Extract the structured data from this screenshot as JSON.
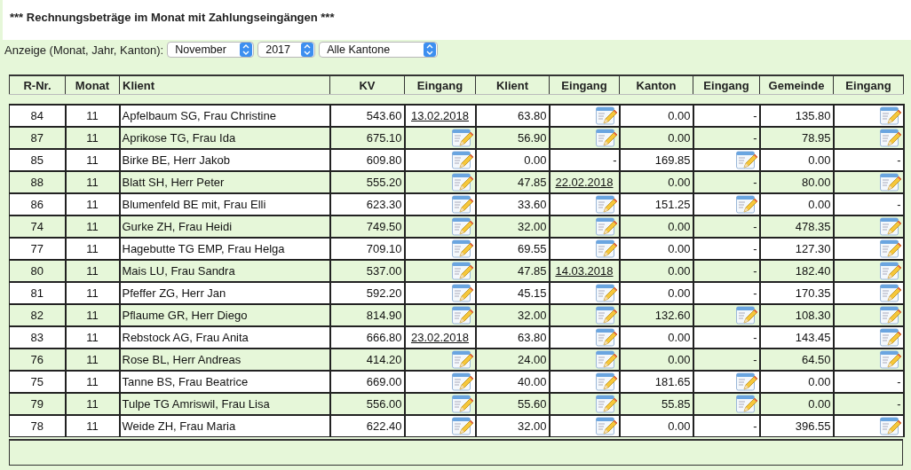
{
  "title": "*** Rechnungsbeträge im Monat mit Zahlungseingängen ***",
  "filter": {
    "label": "Anzeige (Monat, Jahr, Kanton):",
    "selects": [
      {
        "value": "November"
      },
      {
        "value": "2017"
      },
      {
        "value": "Alle Kantone"
      }
    ]
  },
  "table": {
    "columns": [
      "R-Nr.",
      "Monat",
      "Klient",
      "KV",
      "Eingang",
      "Klient",
      "Eingang",
      "Kanton",
      "Eingang",
      "Gemeinde",
      "Eingang"
    ],
    "rows": [
      {
        "nr": "84",
        "monat": "11",
        "klient": "Apfelbaum SG, Frau Christine",
        "amounts": [
          "543.60",
          "63.80",
          "0.00",
          "135.80"
        ],
        "receipts": [
          {
            "kind": "date",
            "text": "13.02.2018"
          },
          {
            "kind": "edit"
          },
          {
            "kind": "dash",
            "text": "-"
          },
          {
            "kind": "edit"
          }
        ]
      },
      {
        "nr": "87",
        "monat": "11",
        "klient": "Aprikose TG, Frau Ida",
        "amounts": [
          "675.10",
          "56.90",
          "0.00",
          "78.95"
        ],
        "receipts": [
          {
            "kind": "edit"
          },
          {
            "kind": "edit"
          },
          {
            "kind": "dash",
            "text": "-"
          },
          {
            "kind": "edit"
          }
        ]
      },
      {
        "nr": "85",
        "monat": "11",
        "klient": "Birke BE, Herr Jakob",
        "amounts": [
          "609.80",
          "0.00",
          "169.85",
          "0.00"
        ],
        "receipts": [
          {
            "kind": "edit"
          },
          {
            "kind": "dash",
            "text": "-"
          },
          {
            "kind": "edit"
          },
          {
            "kind": "dash",
            "text": "-"
          }
        ]
      },
      {
        "nr": "88",
        "monat": "11",
        "klient": "Blatt SH, Herr Peter",
        "amounts": [
          "555.20",
          "47.85",
          "0.00",
          "80.00"
        ],
        "receipts": [
          {
            "kind": "edit"
          },
          {
            "kind": "date",
            "text": "22.02.2018"
          },
          {
            "kind": "dash",
            "text": "-"
          },
          {
            "kind": "edit"
          }
        ]
      },
      {
        "nr": "86",
        "monat": "11",
        "klient": "Blumenfeld BE mit, Frau Elli",
        "amounts": [
          "623.30",
          "33.60",
          "151.25",
          "0.00"
        ],
        "receipts": [
          {
            "kind": "edit"
          },
          {
            "kind": "edit"
          },
          {
            "kind": "edit"
          },
          {
            "kind": "dash",
            "text": "-"
          }
        ]
      },
      {
        "nr": "74",
        "monat": "11",
        "klient": "Gurke ZH, Frau Heidi",
        "amounts": [
          "749.50",
          "32.00",
          "0.00",
          "478.35"
        ],
        "receipts": [
          {
            "kind": "edit"
          },
          {
            "kind": "edit"
          },
          {
            "kind": "dash",
            "text": "-"
          },
          {
            "kind": "edit"
          }
        ]
      },
      {
        "nr": "77",
        "monat": "11",
        "klient": "Hagebutte TG EMP, Frau Helga",
        "amounts": [
          "709.10",
          "69.55",
          "0.00",
          "127.30"
        ],
        "receipts": [
          {
            "kind": "edit"
          },
          {
            "kind": "edit"
          },
          {
            "kind": "dash",
            "text": "-"
          },
          {
            "kind": "edit"
          }
        ]
      },
      {
        "nr": "80",
        "monat": "11",
        "klient": "Mais LU, Frau Sandra",
        "amounts": [
          "537.00",
          "47.85",
          "0.00",
          "182.40"
        ],
        "receipts": [
          {
            "kind": "edit"
          },
          {
            "kind": "date",
            "text": "14.03.2018"
          },
          {
            "kind": "dash",
            "text": "-"
          },
          {
            "kind": "edit"
          }
        ]
      },
      {
        "nr": "81",
        "monat": "11",
        "klient": "Pfeffer ZG, Herr Jan",
        "amounts": [
          "592.20",
          "45.15",
          "0.00",
          "170.35"
        ],
        "receipts": [
          {
            "kind": "edit"
          },
          {
            "kind": "edit"
          },
          {
            "kind": "dash",
            "text": "-"
          },
          {
            "kind": "edit"
          }
        ]
      },
      {
        "nr": "82",
        "monat": "11",
        "klient": "Pflaume GR, Herr Diego",
        "amounts": [
          "814.90",
          "32.00",
          "132.60",
          "108.30"
        ],
        "receipts": [
          {
            "kind": "edit"
          },
          {
            "kind": "edit"
          },
          {
            "kind": "edit"
          },
          {
            "kind": "edit"
          }
        ]
      },
      {
        "nr": "83",
        "monat": "11",
        "klient": "Rebstock AG, Frau Anita",
        "amounts": [
          "666.80",
          "63.80",
          "0.00",
          "143.45"
        ],
        "receipts": [
          {
            "kind": "date",
            "text": "23.02.2018"
          },
          {
            "kind": "edit"
          },
          {
            "kind": "dash",
            "text": "-"
          },
          {
            "kind": "edit"
          }
        ]
      },
      {
        "nr": "76",
        "monat": "11",
        "klient": "Rose BL, Herr Andreas",
        "amounts": [
          "414.20",
          "24.00",
          "0.00",
          "64.50"
        ],
        "receipts": [
          {
            "kind": "edit"
          },
          {
            "kind": "edit"
          },
          {
            "kind": "dash",
            "text": "-"
          },
          {
            "kind": "edit"
          }
        ]
      },
      {
        "nr": "75",
        "monat": "11",
        "klient": "Tanne BS, Frau Beatrice",
        "amounts": [
          "669.00",
          "40.00",
          "181.65",
          "0.00"
        ],
        "receipts": [
          {
            "kind": "edit"
          },
          {
            "kind": "edit"
          },
          {
            "kind": "edit"
          },
          {
            "kind": "dash",
            "text": "-"
          }
        ]
      },
      {
        "nr": "79",
        "monat": "11",
        "klient": "Tulpe TG Amriswil, Frau Lisa",
        "amounts": [
          "556.00",
          "55.60",
          "55.85",
          "0.00"
        ],
        "receipts": [
          {
            "kind": "edit"
          },
          {
            "kind": "edit"
          },
          {
            "kind": "edit"
          },
          {
            "kind": "dash",
            "text": "-"
          }
        ]
      },
      {
        "nr": "78",
        "monat": "11",
        "klient": "Weide ZH, Frau Maria",
        "amounts": [
          "622.40",
          "32.00",
          "0.00",
          "396.55"
        ],
        "receipts": [
          {
            "kind": "edit"
          },
          {
            "kind": "edit"
          },
          {
            "kind": "dash",
            "text": "-"
          },
          {
            "kind": "edit"
          }
        ]
      }
    ]
  }
}
